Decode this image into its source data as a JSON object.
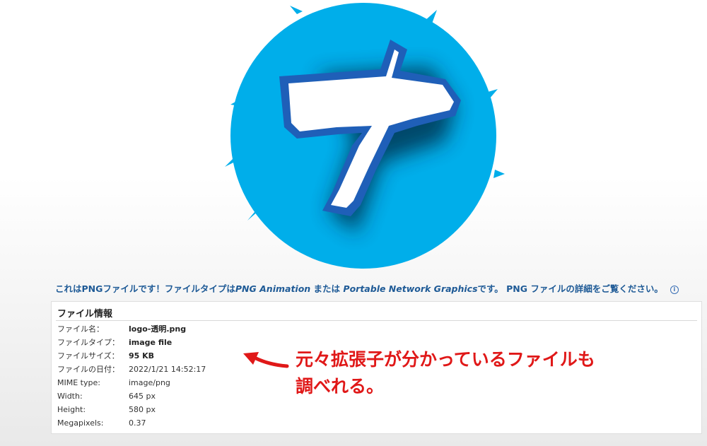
{
  "logo": {
    "glyph": "ナ",
    "circle_color": "#00aeea",
    "glyph_color": "#ffffff",
    "outline_color": "#1f5fb8"
  },
  "info_line": {
    "part1": "これはPNGファイルです！ファイルタイプは",
    "link1": "PNG Animation",
    "part2": " または ",
    "link2": "Portable Network Graphics",
    "part3": "です。 PNG ファイルの詳細をご覧ください。",
    "icon": "i"
  },
  "panel": {
    "title": "ファイル情報",
    "rows": [
      {
        "key": "ファイル名：",
        "value": "logo-透明.png",
        "bold": true
      },
      {
        "key": "ファイルタイプ：",
        "value": "image file",
        "bold": true
      },
      {
        "key": "ファイルサイズ：",
        "value": "95 KB",
        "bold": true
      },
      {
        "key": "ファイルの日付：",
        "value": "2022/1/21 14:52:17",
        "bold": false
      },
      {
        "key": "MIME type:",
        "value": "image/png",
        "bold": false
      },
      {
        "key": "Width:",
        "value": "645 px",
        "bold": false
      },
      {
        "key": "Height:",
        "value": "580 px",
        "bold": false
      },
      {
        "key": "Megapixels:",
        "value": "0.37",
        "bold": false
      }
    ]
  },
  "annotation": {
    "line1": "元々拡張子が分かっているファイルも",
    "line2": "調べれる。",
    "color": "#e01818"
  }
}
